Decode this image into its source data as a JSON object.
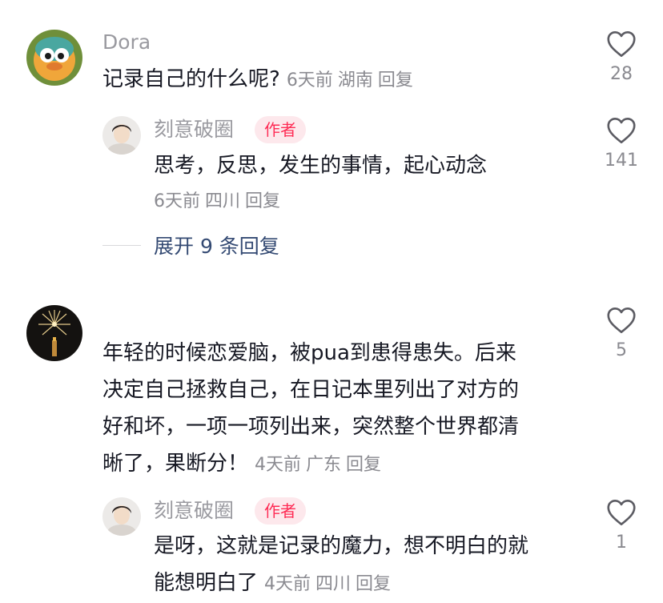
{
  "comments": [
    {
      "user": "Dora",
      "text_lines": [
        "记录自己的什么呢?"
      ],
      "meta": {
        "time": "6天前",
        "location": "湖南",
        "reply": "回复"
      },
      "likes": "28",
      "replies": [
        {
          "user": "刻意破圈",
          "badge": "作者",
          "text_lines": [
            "思考，反思，发生的事情，起心动念"
          ],
          "meta": {
            "time": "6天前",
            "location": "四川",
            "reply": "回复"
          },
          "likes": "141"
        }
      ],
      "expand_label": "展开 9 条回复"
    },
    {
      "user": "",
      "text_lines": [
        "年轻的时候恋爱脑，被pua到患得患失。后来",
        "决定自己拯救自己，在日记本里列出了对方的",
        "好和坏，一项一项列出来，突然整个世界都清",
        "晰了，果断分！"
      ],
      "meta": {
        "time": "4天前",
        "location": "广东",
        "reply": "回复"
      },
      "likes": "5",
      "replies": [
        {
          "user": "刻意破圈",
          "badge": "作者",
          "text_lines": [
            "是呀，这就是记录的魔力，想不明白的就",
            "能想明白了"
          ],
          "meta": {
            "time": "4天前",
            "location": "四川",
            "reply": "回复"
          },
          "likes": "1"
        }
      ]
    }
  ],
  "icons": {
    "like": "heart-outline-icon"
  },
  "colors": {
    "author_badge_bg": "#fde8ec",
    "author_badge_text": "#fe2c55",
    "expand_text": "#344a73",
    "meta_text": "#8a8a90",
    "username_text": "#9a9aa0"
  }
}
